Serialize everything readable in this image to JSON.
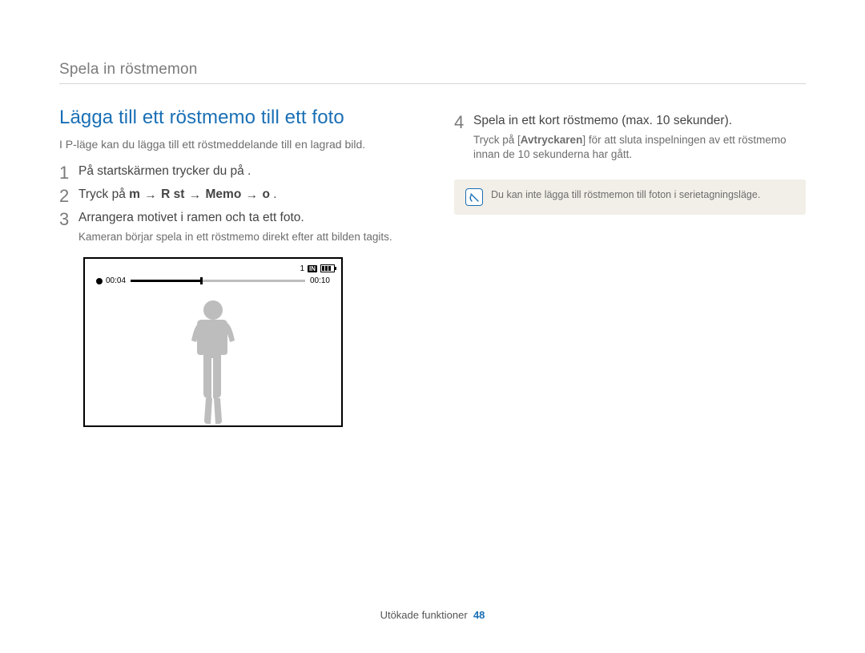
{
  "breadcrumb": "Spela in röstmemon",
  "section_title": "Lägga till ett röstmemo till ett foto",
  "intro": "I P-läge kan du lägga till ett röstmeddelande till en lagrad bild.",
  "arrow": "→",
  "steps": {
    "s1": {
      "num": "1",
      "text": "På startskärmen trycker du på",
      "trail": " ."
    },
    "s2": {
      "num": "2",
      "prefix": "Tryck på ",
      "m": "m",
      "rst": "R st",
      "memo": "Memo",
      "o": "o",
      "trail": "."
    },
    "s3": {
      "num": "3",
      "text": "Arrangera motivet i ramen och ta ett foto.",
      "note": "Kameran börjar spela in ett röstmemo direkt efter att bilden tagits."
    },
    "s4": {
      "num": "4",
      "text": "Spela in ett kort röstmemo (max. 10 sekunder).",
      "note_pre": "Tryck på [",
      "note_bold": "Avtryckaren",
      "note_post": "] för att sluta inspelningen av ett röstmemo innan de 10 sekunderna har gått."
    }
  },
  "camera": {
    "count": "1",
    "in": "IN",
    "elapsed": "00:04",
    "total": "00:10"
  },
  "note_box": "Du kan inte lägga till röstmemon till foton i serietagningsläge.",
  "footer_section": "Utökade funktioner",
  "footer_page": "48"
}
